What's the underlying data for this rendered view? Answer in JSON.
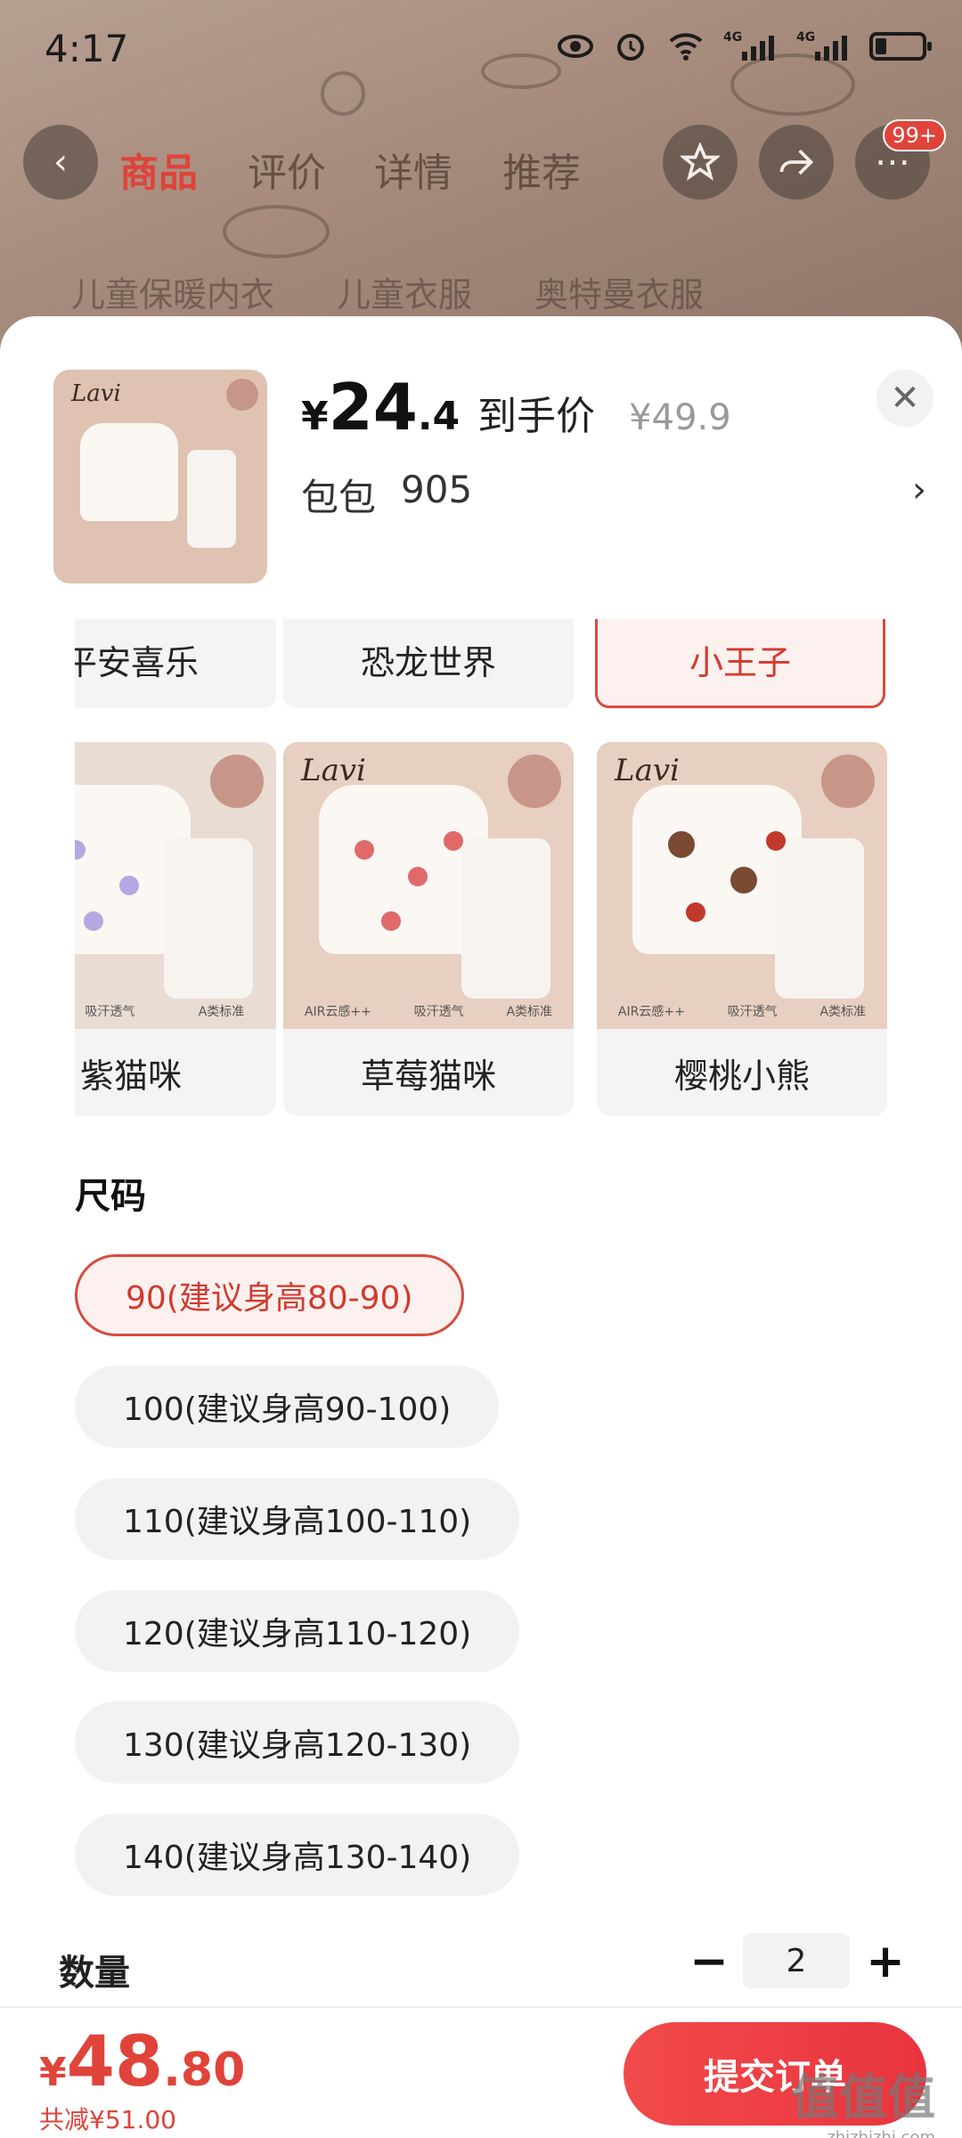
{
  "status_bar": {
    "time": "4:17",
    "net1": "4G",
    "net2": "4G"
  },
  "nav": {
    "tabs": [
      "商品",
      "评价",
      "详情",
      "推荐"
    ],
    "badge": "99+"
  },
  "bg_search": [
    "儿童保暖内衣",
    "儿童衣服",
    "奥特曼衣服"
  ],
  "header": {
    "currency": "¥",
    "price_int": "24",
    "price_dec": ".4",
    "price_label": "到手价",
    "original_price": "¥49.9",
    "address_name": "包包",
    "address_code": "905",
    "brand": "Lavi"
  },
  "styles_row": {
    "items": [
      {
        "label": "平安喜乐",
        "selected": false
      },
      {
        "label": "恐龙世界",
        "selected": false
      },
      {
        "label": "小王子",
        "selected": true
      }
    ]
  },
  "style_cards": [
    {
      "label": "紫猫咪",
      "brand": "",
      "dot_color": "#b7a6e2",
      "features": [
        "吸汗透气",
        "A类标准"
      ]
    },
    {
      "label": "草莓猫咪",
      "brand": "Lavi",
      "dot_color": "#e06a6a",
      "features": [
        "AIR云感++",
        "吸汗透气",
        "A类标准"
      ]
    },
    {
      "label": "樱桃小熊",
      "brand": "Lavi",
      "dot_color": "#7a4a32",
      "features": [
        "AIR云感++",
        "吸汗透气",
        "A类标准"
      ]
    }
  ],
  "size": {
    "title": "尺码",
    "options": [
      {
        "label": "90(建议身高80-90)",
        "selected": true
      },
      {
        "label": "100(建议身高90-100)",
        "selected": false
      },
      {
        "label": "110(建议身高100-110)",
        "selected": false
      },
      {
        "label": "120(建议身高110-120)",
        "selected": false
      },
      {
        "label": "130(建议身高120-130)",
        "selected": false
      },
      {
        "label": "140(建议身高130-140)",
        "selected": false
      }
    ]
  },
  "quantity": {
    "title": "数量",
    "value": "2",
    "minus": "−",
    "plus": "+"
  },
  "footer": {
    "currency": "¥",
    "total_int": "48",
    "total_dec": ".80",
    "saved": "共减¥51.00",
    "submit_label": "提交订单"
  },
  "watermark": {
    "text": "值值值",
    "sub": "zhizhizhi.com"
  },
  "colors": {
    "accent": "#e0433a",
    "selected_bg": "#fdf1ef",
    "pill_bg": "#f2f2f2"
  }
}
